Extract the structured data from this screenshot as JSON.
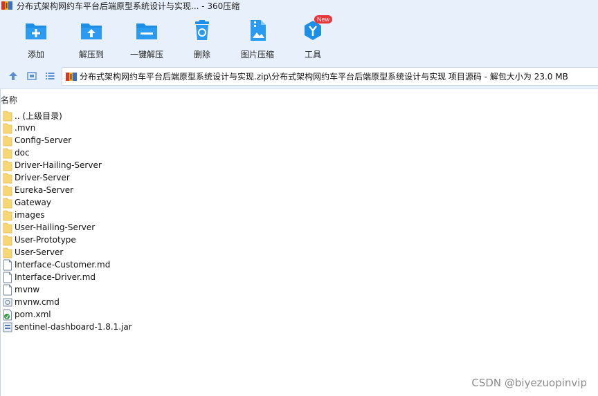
{
  "window": {
    "title": "分布式架构网约车平台后端原型系统设计与实现... - 360压缩"
  },
  "toolbar": {
    "items": [
      {
        "id": "add",
        "label": "添加",
        "icon": "add-folder-icon"
      },
      {
        "id": "extract",
        "label": "解压到",
        "icon": "extract-to-icon"
      },
      {
        "id": "one-click",
        "label": "一键解压",
        "icon": "one-click-extract-icon"
      },
      {
        "id": "delete",
        "label": "删除",
        "icon": "trash-icon"
      },
      {
        "id": "image",
        "label": "图片压缩",
        "icon": "image-compress-icon"
      },
      {
        "id": "tools",
        "label": "工具",
        "icon": "tools-icon",
        "badge": "New"
      }
    ]
  },
  "address": {
    "path": "分布式架构网约车平台后端原型系统设计与实现.zip\\分布式架构网约车平台后端原型系统设计与实现 项目源码 - 解包大小为 23.0 MB"
  },
  "list": {
    "column_name": "名称",
    "rows": [
      {
        "name": ".. (上级目录)",
        "type": "folder"
      },
      {
        "name": ".mvn",
        "type": "folder"
      },
      {
        "name": "Config-Server",
        "type": "folder"
      },
      {
        "name": "doc",
        "type": "folder"
      },
      {
        "name": "Driver-Hailing-Server",
        "type": "folder"
      },
      {
        "name": "Driver-Server",
        "type": "folder"
      },
      {
        "name": "Eureka-Server",
        "type": "folder"
      },
      {
        "name": "Gateway",
        "type": "folder"
      },
      {
        "name": "images",
        "type": "folder"
      },
      {
        "name": "User-Hailing-Server",
        "type": "folder"
      },
      {
        "name": "User-Prototype",
        "type": "folder"
      },
      {
        "name": "User-Server",
        "type": "folder"
      },
      {
        "name": "Interface-Customer.md",
        "type": "file"
      },
      {
        "name": "Interface-Driver.md",
        "type": "file"
      },
      {
        "name": "mvnw",
        "type": "file"
      },
      {
        "name": "mvnw.cmd",
        "type": "cmd"
      },
      {
        "name": "pom.xml",
        "type": "xml"
      },
      {
        "name": "sentinel-dashboard-1.8.1.jar",
        "type": "jar"
      }
    ]
  },
  "watermark": "CSDN @biyezuopinvip",
  "colors": {
    "toolbar_bg": "#e8f1fb",
    "icon_blue": "#1d8ee6",
    "folder_yellow": "#f7d676",
    "badge_red": "#e8353a"
  }
}
